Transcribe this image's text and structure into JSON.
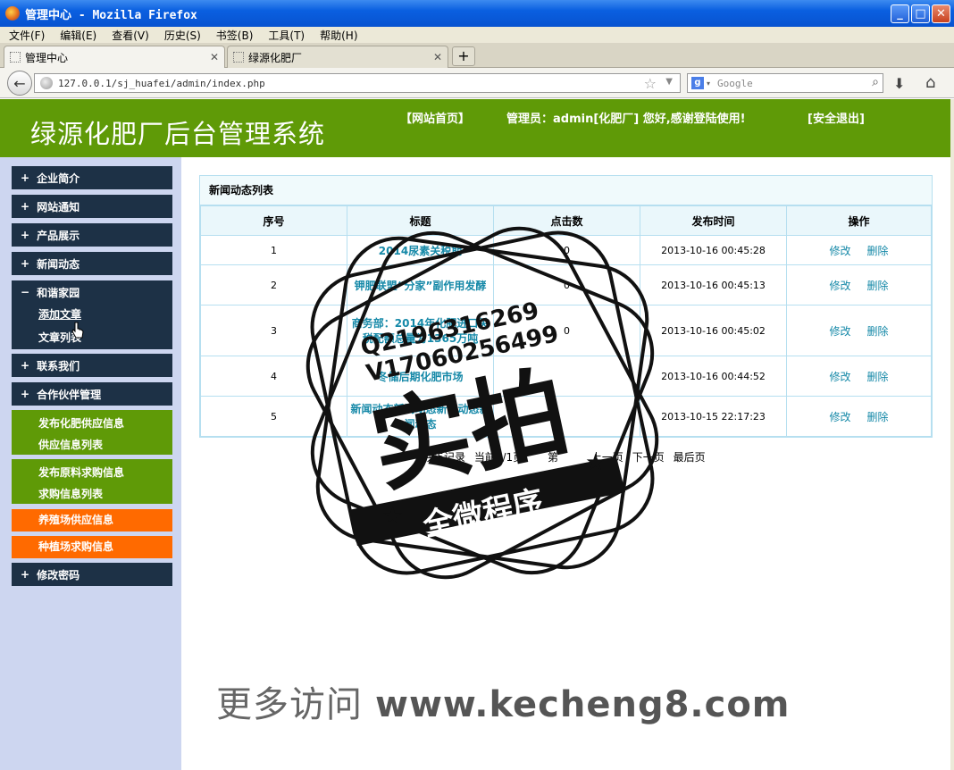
{
  "window": {
    "title": "管理中心 - Mozilla Firefox"
  },
  "menu": [
    "文件(F)",
    "编辑(E)",
    "查看(V)",
    "历史(S)",
    "书签(B)",
    "工具(T)",
    "帮助(H)"
  ],
  "tabs": [
    {
      "label": "管理中心",
      "active": true
    },
    {
      "label": "绿源化肥厂",
      "active": false
    }
  ],
  "nav": {
    "url": "127.0.0.1/sj_huafei/admin/index.php",
    "search_placeholder": "Google"
  },
  "header": {
    "site_title": "绿源化肥厂后台管理系统",
    "home_link": "【网站首页】",
    "admin_greeting": "管理员：admin[化肥厂] 您好,感谢登陆使用!",
    "logout_link": "[安全退出]"
  },
  "sidebar": {
    "items": [
      "企业简介",
      "网站通知",
      "产品展示",
      "新闻动态"
    ],
    "expanded": {
      "label": "和谐家园",
      "sub": [
        "添加文章",
        "文章列表"
      ]
    },
    "items_after": [
      "联系我们",
      "合作伙伴管理"
    ],
    "green1": [
      "发布化肥供应信息",
      "供应信息列表"
    ],
    "green2": [
      "发布原料求购信息",
      "求购信息列表"
    ],
    "orange": [
      "养殖场供应信息",
      "种植场求购信息"
    ],
    "last": "修改密码",
    "plus_symbol": "+",
    "minus_symbol": "−"
  },
  "table": {
    "title": "新闻动态列表",
    "headers": [
      "序号",
      "标题",
      "点击数",
      "发布时间",
      "操作"
    ],
    "rows": [
      {
        "no": "1",
        "title": "2014尿素关税期",
        "clicks": "0",
        "time": "2013-10-16 00:45:28"
      },
      {
        "no": "2",
        "title": "钾肥联盟“分家”副作用发酵",
        "clicks": "0",
        "time": "2013-10-16 00:45:13"
      },
      {
        "no": "3",
        "title": "商务部：2014年化肥进口关税配额总量为1365万吨",
        "clicks": "0",
        "time": "2013-10-16 00:45:02"
      },
      {
        "no": "4",
        "title": "冬储后期化肥市场",
        "clicks": "",
        "time": "2013-10-16 00:44:52"
      },
      {
        "no": "5",
        "title": "新闻动态新闻动态新闻动态新闻动态",
        "clicks": "",
        "time": "2013-10-15 22:17:23"
      }
    ],
    "edit_label": "修改",
    "delete_label": "删除"
  },
  "pager": {
    "total": "共5记录",
    "current": "当前1/1页",
    "page_label": "第",
    "prev": "上一页",
    "next": "下一页",
    "last": "最后页"
  },
  "watermark": {
    "qq": "Q2196316269",
    "v": "V17060256499",
    "big": "实拍",
    "banner": "全微程序",
    "footer_cn": "更多访问",
    "footer_url": "www.kecheng8.com"
  }
}
